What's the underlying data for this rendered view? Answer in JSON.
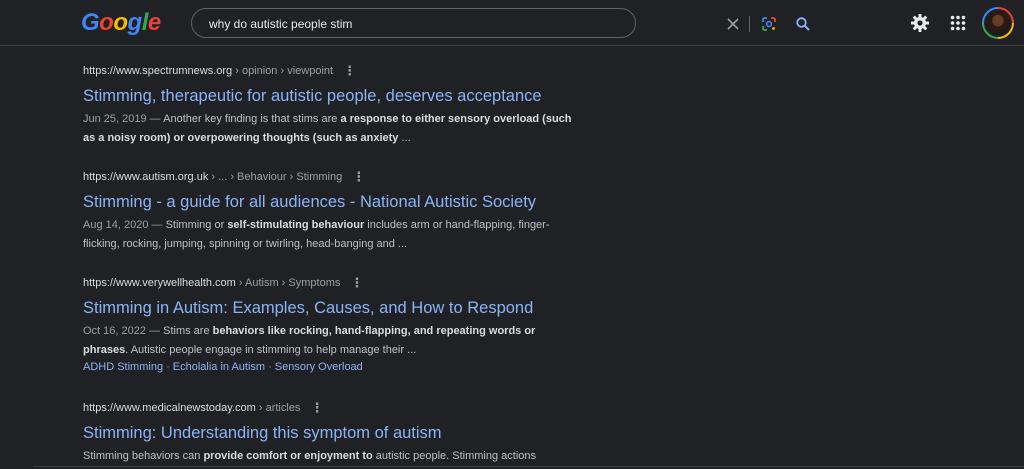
{
  "search": {
    "query": "why do autistic people stim",
    "logo_letters": [
      {
        "ch": "G",
        "color": "#4285f4"
      },
      {
        "ch": "o",
        "color": "#ea4335"
      },
      {
        "ch": "o",
        "color": "#fbbc05"
      },
      {
        "ch": "g",
        "color": "#4285f4"
      },
      {
        "ch": "l",
        "color": "#34a853"
      },
      {
        "ch": "e",
        "color": "#ea4335"
      }
    ]
  },
  "icons": {
    "clear": "close-icon",
    "lens": "google-lens-icon",
    "search": "search-icon",
    "settings": "gear-icon",
    "apps": "apps-grid-icon",
    "account": "avatar"
  },
  "results": [
    {
      "host": "https://www.spectrumnews.org",
      "path": " › opinion › viewpoint",
      "title": "Stimming, therapeutic for autistic people, deserves acceptance",
      "snippet": [
        {
          "t": "Jun 25, 2019 — ",
          "date": true
        },
        {
          "t": "Another key finding is that stims are "
        },
        {
          "t": "a response to either sensory overload (such as a noisy room) or overpowering thoughts (such as anxiety",
          "b": true
        },
        {
          "t": " ..."
        }
      ]
    },
    {
      "host": "https://www.autism.org.uk",
      "path": " › ... › Behaviour › Stimming",
      "title": "Stimming - a guide for all audiences - National Autistic Society",
      "snippet": [
        {
          "t": "Aug 14, 2020 — ",
          "date": true
        },
        {
          "t": "Stimming or "
        },
        {
          "t": "self-stimulating behaviour",
          "b": true
        },
        {
          "t": " includes arm or hand-flapping, finger-flicking, rocking, jumping, spinning or twirling, head-banging and ..."
        }
      ]
    },
    {
      "host": "https://www.verywellhealth.com",
      "path": " › Autism › Symptoms",
      "title": "Stimming in Autism: Examples, Causes, and How to Respond",
      "snippet": [
        {
          "t": "Oct 16, 2022 — ",
          "date": true
        },
        {
          "t": "Stims are "
        },
        {
          "t": "behaviors like rocking, hand-flapping, and repeating words or phrases",
          "b": true
        },
        {
          "t": ". Autistic people engage in stimming to help manage their ..."
        }
      ],
      "sitelinks": [
        "ADHD Stimming",
        "Echolalia in Autism",
        "Sensory Overload"
      ]
    },
    {
      "host": "https://www.medicalnewstoday.com",
      "path": " › articles",
      "title": "Stimming: Understanding this symptom of autism",
      "snippet": [
        {
          "t": "Stimming behaviors can "
        },
        {
          "t": "provide comfort or enjoyment to",
          "b": true
        },
        {
          "t": " autistic people. Stimming actions"
        }
      ]
    }
  ]
}
